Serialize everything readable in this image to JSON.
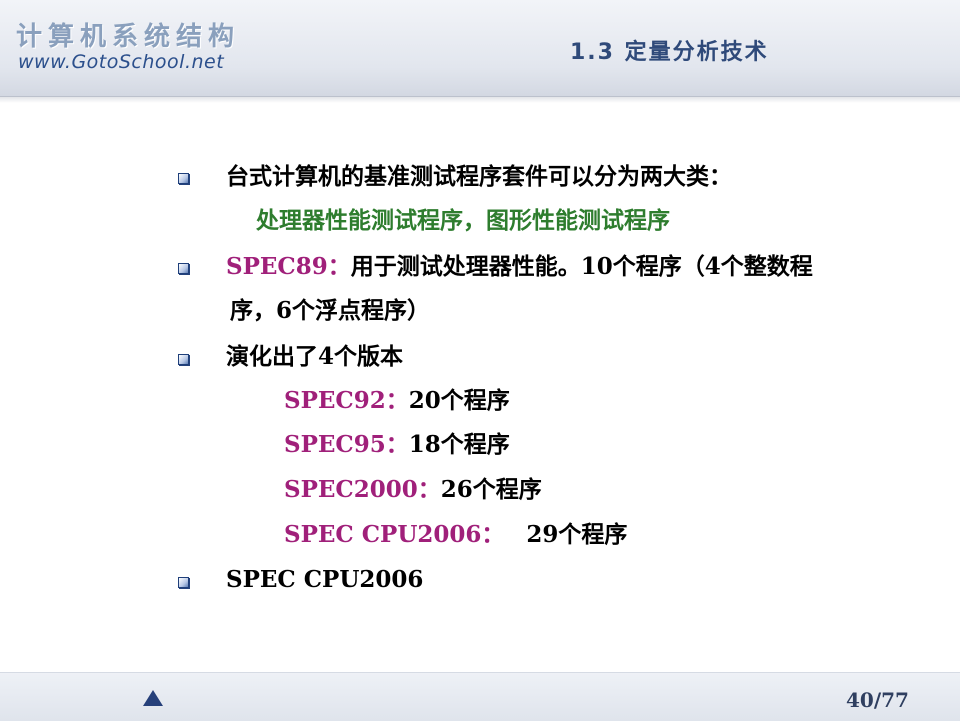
{
  "header": {
    "logo_cn": "计算机系统结构",
    "logo_url": "www.GotoSchool.net",
    "title": "1.3 定量分析技术"
  },
  "content": {
    "b1": "台式计算机的基准测试程序套件可以分为两大类：",
    "b1_sub": "处理器性能测试程序，图形性能测试程序",
    "b2_spec": "SPEC89：",
    "b2_text": "用于测试处理器性能。10个程序（4个整数程",
    "b2_cont": "序，6个浮点程序）",
    "b3": "演化出了4个版本",
    "versions": [
      {
        "name": "SPEC92：",
        "desc": "20个程序"
      },
      {
        "name": "SPEC95：",
        "desc": "18个程序"
      },
      {
        "name": "SPEC2000：",
        "desc": "26个程序"
      },
      {
        "name": "SPEC CPU2006：",
        "desc": "29个程序"
      }
    ],
    "b4": "SPEC CPU2006"
  },
  "footer": {
    "nav_icon": "triangle-up-icon",
    "page": "40/77"
  },
  "colors": {
    "title": "#2f4a7a",
    "green": "#2e7d2e",
    "spec": "#a0207a",
    "bullet": "#1f3f7a"
  }
}
